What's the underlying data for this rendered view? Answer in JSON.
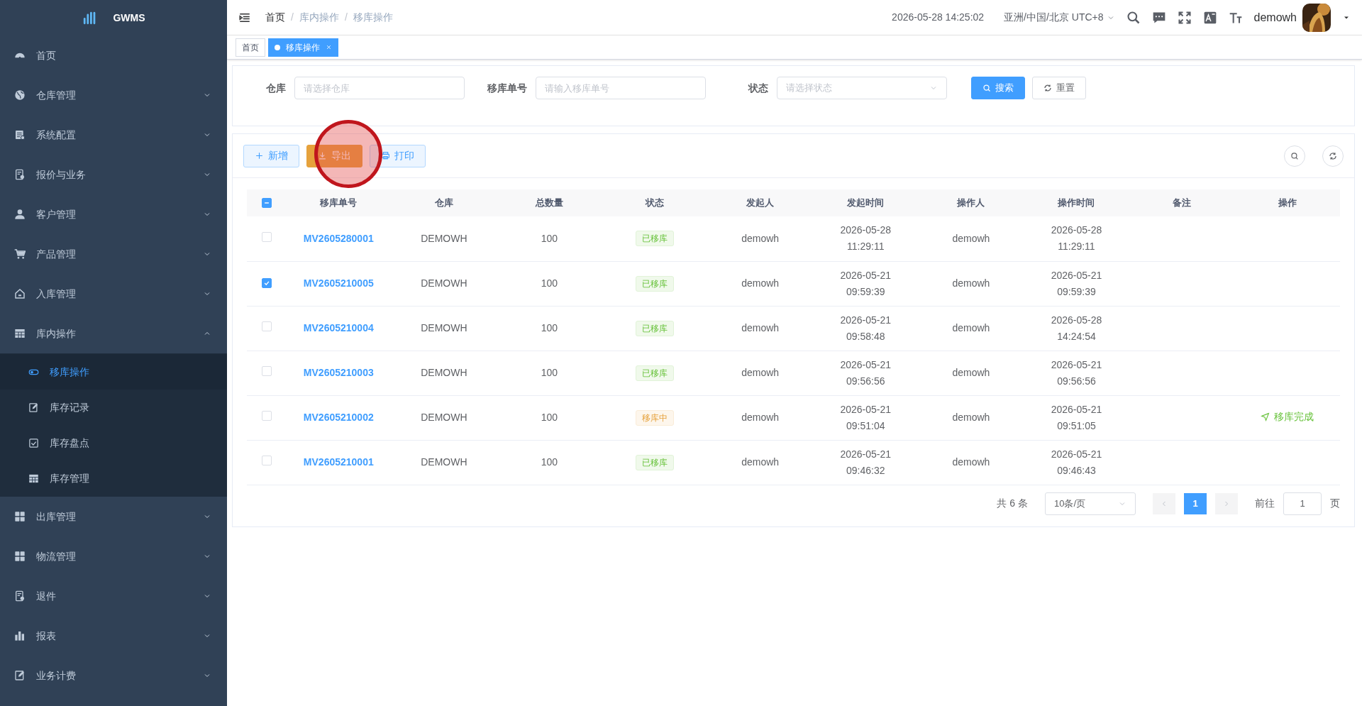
{
  "logo": {
    "text": "GWMS"
  },
  "sidebar": {
    "items": [
      {
        "label": "首页"
      },
      {
        "label": "仓库管理",
        "expanded": false
      },
      {
        "label": "系统配置",
        "expanded": false
      },
      {
        "label": "报价与业务",
        "expanded": false
      },
      {
        "label": "客户管理",
        "expanded": false
      },
      {
        "label": "产品管理",
        "expanded": false
      },
      {
        "label": "入库管理",
        "expanded": false
      },
      {
        "label": "库内操作",
        "expanded": true,
        "children": [
          {
            "label": "移库操作",
            "selected": true
          },
          {
            "label": "库存记录",
            "selected": false
          },
          {
            "label": "库存盘点",
            "selected": false
          },
          {
            "label": "库存管理",
            "selected": false
          }
        ]
      },
      {
        "label": "出库管理",
        "expanded": false
      },
      {
        "label": "物流管理",
        "expanded": false
      },
      {
        "label": "退件",
        "expanded": false
      },
      {
        "label": "报表",
        "expanded": false
      },
      {
        "label": "业务计费",
        "expanded": false
      }
    ]
  },
  "breadcrumb": [
    {
      "label": "首页"
    },
    {
      "separator": "/",
      "label": "库内操作"
    },
    {
      "separator": "/",
      "label": "移库操作"
    }
  ],
  "header": {
    "datetime": "2026-05-28 14:25:02",
    "timezone": "亚洲/中国/北京 UTC+8",
    "username": "demowh"
  },
  "tabs": [
    {
      "label": "首页",
      "selected": false
    },
    {
      "label": "移库操作",
      "selected": true
    }
  ],
  "filters": [
    {
      "label": "仓库",
      "placeholder": "请选择仓库",
      "kind": "input"
    },
    {
      "label": "移库单号",
      "placeholder": "请输入移库单号",
      "kind": "input"
    },
    {
      "label": "状态",
      "placeholder": "请选择状态",
      "kind": "select"
    }
  ],
  "filter_buttons": [
    {
      "label": "搜索",
      "kind": "primary"
    },
    {
      "label": "重置",
      "kind": "plain"
    }
  ],
  "toolbar": [
    {
      "label": "新增",
      "kind": "add"
    },
    {
      "label": "导出",
      "kind": "export"
    },
    {
      "label": "打印",
      "kind": "print"
    }
  ],
  "table": {
    "select_all_indeterminate": true,
    "columns": [
      "移库单号",
      "仓库",
      "总数量",
      "状态",
      "发起人",
      "发起时间",
      "操作人",
      "操作时间",
      "备注",
      "操作"
    ],
    "rows": [
      {
        "selected": false,
        "id": "MV2605280001",
        "warehouse": "DEMOWH",
        "qty": "100",
        "status": {
          "text": "已移库",
          "kind": "done"
        },
        "initiator": "demowh",
        "start_date": "2026-05-28",
        "start_time": "11:29:11",
        "operator": "demowh",
        "op_date": "2026-05-28",
        "op_time": "11:29:11"
      },
      {
        "selected": true,
        "id": "MV2605210005",
        "warehouse": "DEMOWH",
        "qty": "100",
        "status": {
          "text": "已移库",
          "kind": "done"
        },
        "initiator": "demowh",
        "start_date": "2026-05-21",
        "start_time": "09:59:39",
        "operator": "demowh",
        "op_date": "2026-05-21",
        "op_time": "09:59:39"
      },
      {
        "selected": false,
        "id": "MV2605210004",
        "warehouse": "DEMOWH",
        "qty": "100",
        "status": {
          "text": "已移库",
          "kind": "done"
        },
        "initiator": "demowh",
        "start_date": "2026-05-21",
        "start_time": "09:58:48",
        "operator": "demowh",
        "op_date": "2026-05-28",
        "op_time": "14:24:54"
      },
      {
        "selected": false,
        "id": "MV2605210003",
        "warehouse": "DEMOWH",
        "qty": "100",
        "status": {
          "text": "已移库",
          "kind": "done"
        },
        "initiator": "demowh",
        "start_date": "2026-05-21",
        "start_time": "09:56:56",
        "operator": "demowh",
        "op_date": "2026-05-21",
        "op_time": "09:56:56"
      },
      {
        "selected": false,
        "id": "MV2605210002",
        "warehouse": "DEMOWH",
        "qty": "100",
        "status": {
          "text": "移库中",
          "kind": "moving"
        },
        "initiator": "demowh",
        "start_date": "2026-05-21",
        "start_time": "09:51:04",
        "operator": "demowh",
        "op_date": "2026-05-21",
        "op_time": "09:51:05",
        "action": "移库完成"
      },
      {
        "selected": false,
        "id": "MV2605210001",
        "warehouse": "DEMOWH",
        "qty": "100",
        "status": {
          "text": "已移库",
          "kind": "done"
        },
        "initiator": "demowh",
        "start_date": "2026-05-21",
        "start_time": "09:46:32",
        "operator": "demowh",
        "op_date": "2026-05-21",
        "op_time": "09:46:43"
      }
    ]
  },
  "pagination": {
    "total": "共 6 条",
    "page_size": "10条/页",
    "pages": [
      {
        "label": "1",
        "selected": true
      }
    ],
    "goto_label": "前往",
    "goto_value": "1",
    "goto_suffix": "页"
  }
}
